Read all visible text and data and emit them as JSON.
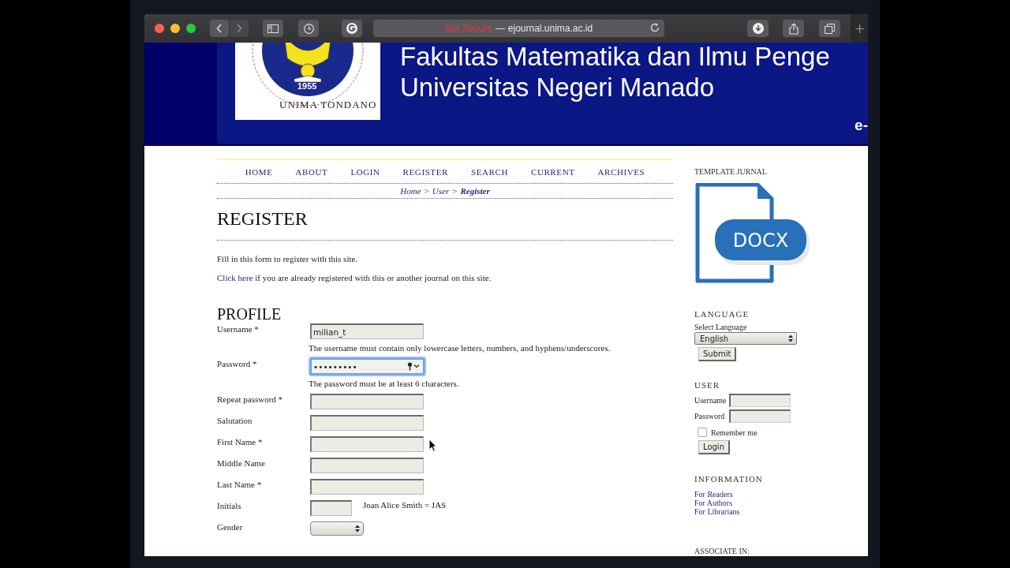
{
  "browser": {
    "address": {
      "security": "Not Secure",
      "separator": "—",
      "host": "ejournal.unima.ac.id"
    }
  },
  "banner": {
    "logo_year": "1955",
    "logo_name": "UNIMA TONDANO",
    "title_lines": [
      "Fakultas Matematika dan Ilmu Penge",
      "Universitas Negeri Manado"
    ],
    "tag": "e-"
  },
  "nav": [
    {
      "label": "HOME"
    },
    {
      "label": "ABOUT"
    },
    {
      "label": "LOGIN"
    },
    {
      "label": "REGISTER"
    },
    {
      "label": "SEARCH"
    },
    {
      "label": "CURRENT"
    },
    {
      "label": "ARCHIVES"
    }
  ],
  "breadcrumb": {
    "separator": ">",
    "items": [
      {
        "label": "Home",
        "current": false
      },
      {
        "label": "User",
        "current": false
      },
      {
        "label": "Register",
        "current": true
      }
    ]
  },
  "page_title": "REGISTER",
  "intro": "Fill in this form to register with this site.",
  "login_note": {
    "link": "Click here",
    "text": "if you are already registered with this or another journal on this site."
  },
  "section_title": "PROFILE",
  "fields": [
    {
      "kind": "text",
      "label": "Username *",
      "value": "milian_t",
      "focused": false,
      "hint": "The username must contain only lowercase letters, numbers, and hyphens/underscores."
    },
    {
      "kind": "password",
      "label": "Password *",
      "value": "•••••••••",
      "focused": true,
      "hint": "The password must be at least 6 characters."
    },
    {
      "kind": "text",
      "label": "Repeat password *",
      "focused": false
    },
    {
      "kind": "text",
      "label": "Salutation",
      "focused": false
    },
    {
      "kind": "text",
      "label": "First Name *",
      "focused": false
    },
    {
      "kind": "text",
      "label": "Middle Name",
      "focused": false
    },
    {
      "kind": "text",
      "label": "Last Name *",
      "focused": false
    },
    {
      "kind": "short",
      "label": "Initials",
      "focused": false,
      "note": "Joan Alice Smith = JAS"
    },
    {
      "kind": "select",
      "label": "Gender",
      "focused": false
    }
  ],
  "sidebar": {
    "template": {
      "title": "TEMPLATE JURNAL",
      "icon_label": "DOCX"
    },
    "language": {
      "title": "LANGUAGE",
      "label": "Select Language",
      "value": "English",
      "button": "Submit"
    },
    "user": {
      "title": "USER",
      "username_label": "Username",
      "password_label": "Password",
      "remember": {
        "label": "Remember me",
        "checked": false
      },
      "button": "Login"
    },
    "information": {
      "title": "INFORMATION",
      "links": [
        "For Readers",
        "For Authors",
        "For Librarians"
      ]
    },
    "associate": {
      "title": "ASSOCIATE IN:"
    }
  }
}
